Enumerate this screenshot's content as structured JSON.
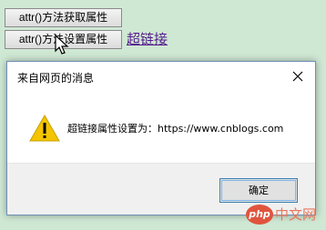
{
  "page": {
    "buttons": {
      "get_attr_label": "attr()方法获取属性",
      "set_attr_label": "attr()方法设置属性"
    },
    "link_text": "超链接"
  },
  "dialog": {
    "title": "来自网页的消息",
    "icons": {
      "warning": "warning-icon",
      "close": "close-icon"
    },
    "message": "超链接属性设置为：https://www.cnblogs.com",
    "ok_label": "确定"
  },
  "watermark": {
    "logo_text": "php",
    "site_text": "中文网"
  },
  "colors": {
    "page_background": "#cfe8d4",
    "link": "#551a8b",
    "warning_yellow": "#f4c400",
    "watermark_red": "#e0543d"
  }
}
